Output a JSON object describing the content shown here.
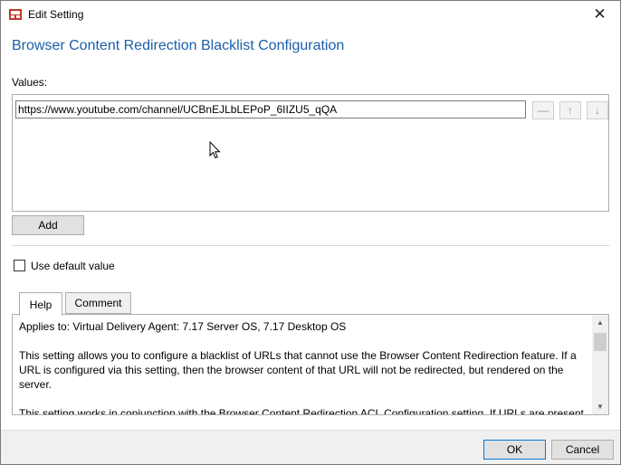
{
  "window": {
    "title": "Edit Setting",
    "close_glyph": "✕",
    "icon": "settings-app-icon"
  },
  "heading": "Browser Content Redirection Blacklist Configuration",
  "values": {
    "label": "Values:",
    "items": [
      "https://www.youtube.com/channel/UCBnEJLbLEPoP_6IIZU5_qQA"
    ],
    "remove_glyph": "—",
    "up_glyph": "↑",
    "down_glyph": "↓"
  },
  "add_label": "Add",
  "use_default": {
    "label": "Use default value",
    "checked": false
  },
  "tabs": [
    {
      "label": "Help",
      "active": true
    },
    {
      "label": "Comment",
      "active": false
    }
  ],
  "help": {
    "paragraphs": [
      "Applies to: Virtual Delivery Agent: 7.17 Server OS, 7.17 Desktop OS",
      "This setting allows you to configure a blacklist of URLs that cannot use the Browser Content Redirection feature. If a URL is configured via this setting, then the browser content of that URL will not be redirected, but rendered on the server.",
      "This setting works in conjunction with the Browser Content Redirection ACL Configuration setting. If URLs are present"
    ]
  },
  "footer": {
    "ok_label": "OK",
    "cancel_label": "Cancel"
  },
  "colors": {
    "heading": "#1b5fa8",
    "primary_button_border": "#0078d7",
    "footer_background": "#f0f0f0"
  }
}
